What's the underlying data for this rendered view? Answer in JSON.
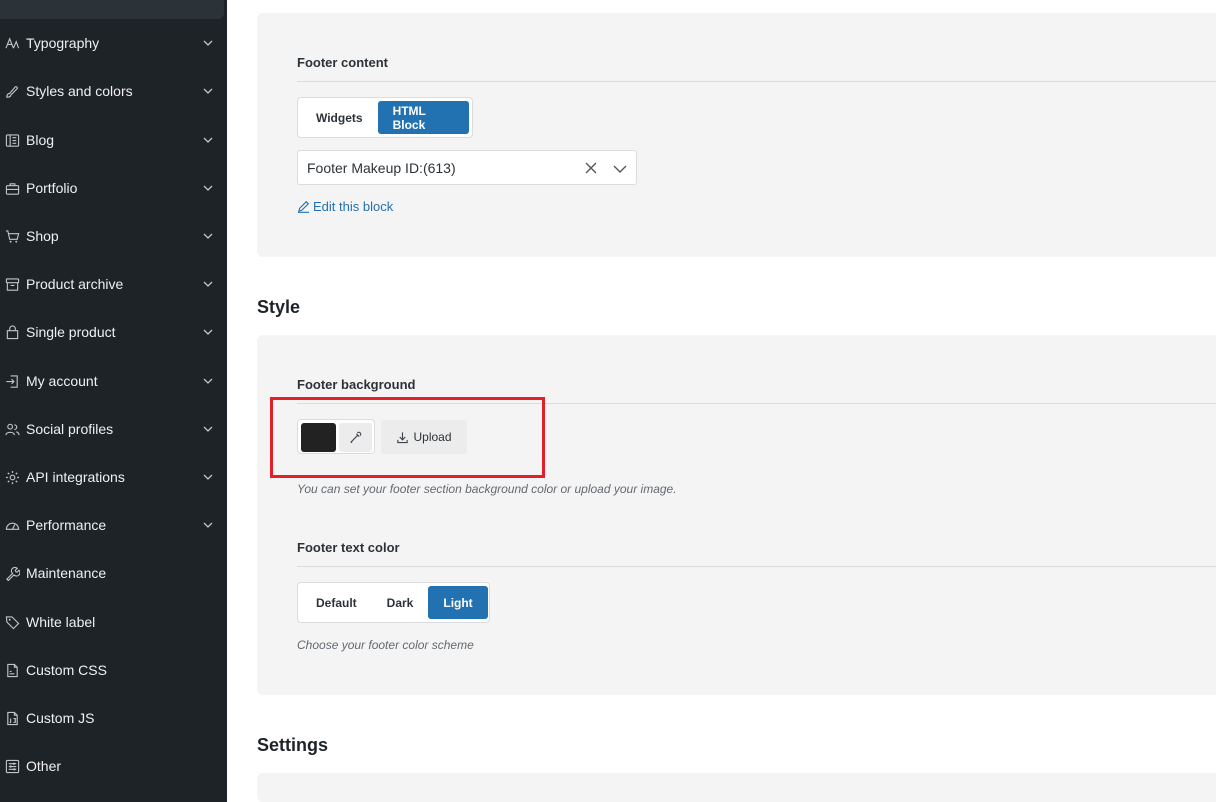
{
  "sidebar": {
    "items": [
      {
        "label": "Typography",
        "icon": "typography-icon",
        "has_chevron": true
      },
      {
        "label": "Styles and colors",
        "icon": "brush-icon",
        "has_chevron": true
      },
      {
        "label": "Blog",
        "icon": "blog-icon",
        "has_chevron": true
      },
      {
        "label": "Portfolio",
        "icon": "briefcase-icon",
        "has_chevron": true
      },
      {
        "label": "Shop",
        "icon": "cart-icon",
        "has_chevron": true
      },
      {
        "label": "Product archive",
        "icon": "archive-icon",
        "has_chevron": true
      },
      {
        "label": "Single product",
        "icon": "bag-icon",
        "has_chevron": true
      },
      {
        "label": "My account",
        "icon": "login-icon",
        "has_chevron": true
      },
      {
        "label": "Social profiles",
        "icon": "users-icon",
        "has_chevron": true
      },
      {
        "label": "API integrations",
        "icon": "gear-icon",
        "has_chevron": true
      },
      {
        "label": "Performance",
        "icon": "gauge-icon",
        "has_chevron": true
      },
      {
        "label": "Maintenance",
        "icon": "wrench-icon",
        "has_chevron": false
      },
      {
        "label": "White label",
        "icon": "tag-icon",
        "has_chevron": false
      },
      {
        "label": "Custom CSS",
        "icon": "css-file-icon",
        "has_chevron": false
      },
      {
        "label": "Custom JS",
        "icon": "js-file-icon",
        "has_chevron": false
      },
      {
        "label": "Other",
        "icon": "sliders-icon",
        "has_chevron": false
      }
    ]
  },
  "footer_content": {
    "title": "Footer content",
    "options": [
      "Widgets",
      "HTML Block"
    ],
    "selected": "HTML Block",
    "block_select_value": "Footer Makeup ID:(613)",
    "edit_link": "Edit this block"
  },
  "style_section": {
    "title": "Style",
    "footer_background": {
      "title": "Footer background",
      "color": "#222222",
      "upload_label": "Upload",
      "hint": "You can set your footer section background color or upload your image."
    },
    "footer_text_color": {
      "title": "Footer text color",
      "options": [
        "Default",
        "Dark",
        "Light"
      ],
      "selected": "Light",
      "hint": "Choose your footer color scheme"
    }
  },
  "settings_section": {
    "title": "Settings"
  },
  "colors": {
    "sidebar_bg": "#1d2327",
    "accent": "#2271b1",
    "highlight_border": "#e2202a"
  }
}
